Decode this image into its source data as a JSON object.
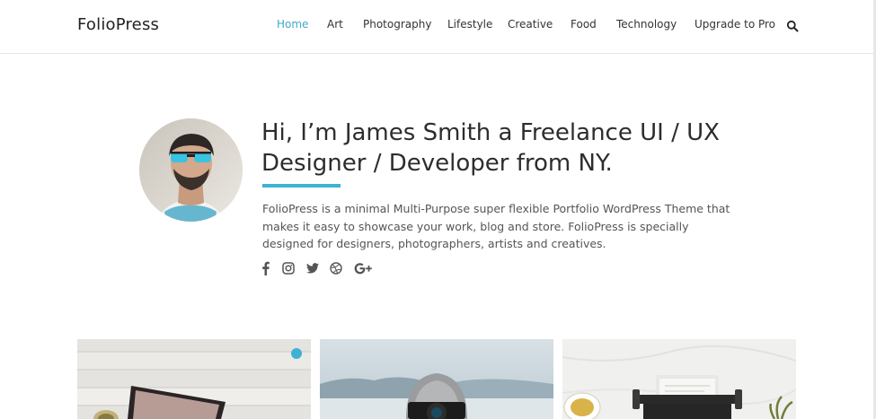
{
  "site": {
    "logo": "FolioPress"
  },
  "nav": {
    "items": [
      {
        "label": "Home",
        "active": true
      },
      {
        "label": "Art",
        "active": false
      },
      {
        "label": "Photography",
        "active": false
      },
      {
        "label": "Lifestyle",
        "active": false
      },
      {
        "label": "Creative",
        "active": false
      },
      {
        "label": "Food",
        "active": false
      },
      {
        "label": "Technology",
        "active": false
      },
      {
        "label": "Upgrade to Pro",
        "active": false
      }
    ],
    "search_icon": "search-icon"
  },
  "hero": {
    "title": "Hi, I’m James Smith a Freelance UI / UX Designer / Developer from NY.",
    "description": "FolioPress is a minimal Multi-Purpose super flexible Portfolio WordPress Theme that makes it easy to showcase your work, blog and store. FolioPress is specially designed for designers, photographers, artists and creatives.",
    "avatar_icon": "avatar",
    "social": [
      {
        "name": "facebook-icon",
        "glyph": "f"
      },
      {
        "name": "instagram-icon",
        "glyph": ""
      },
      {
        "name": "twitter-icon",
        "glyph": ""
      },
      {
        "name": "dribbble-icon",
        "glyph": ""
      },
      {
        "name": "google-plus-icon",
        "glyph": "G+"
      }
    ]
  },
  "cards": [
    {
      "name": "laptop-on-wood-image"
    },
    {
      "name": "photographer-in-snow-image"
    },
    {
      "name": "typewriter-and-tea-image"
    }
  ],
  "colors": {
    "accent": "#3fb2d4",
    "nav_active": "#3fa9c9",
    "text": "#333333"
  }
}
